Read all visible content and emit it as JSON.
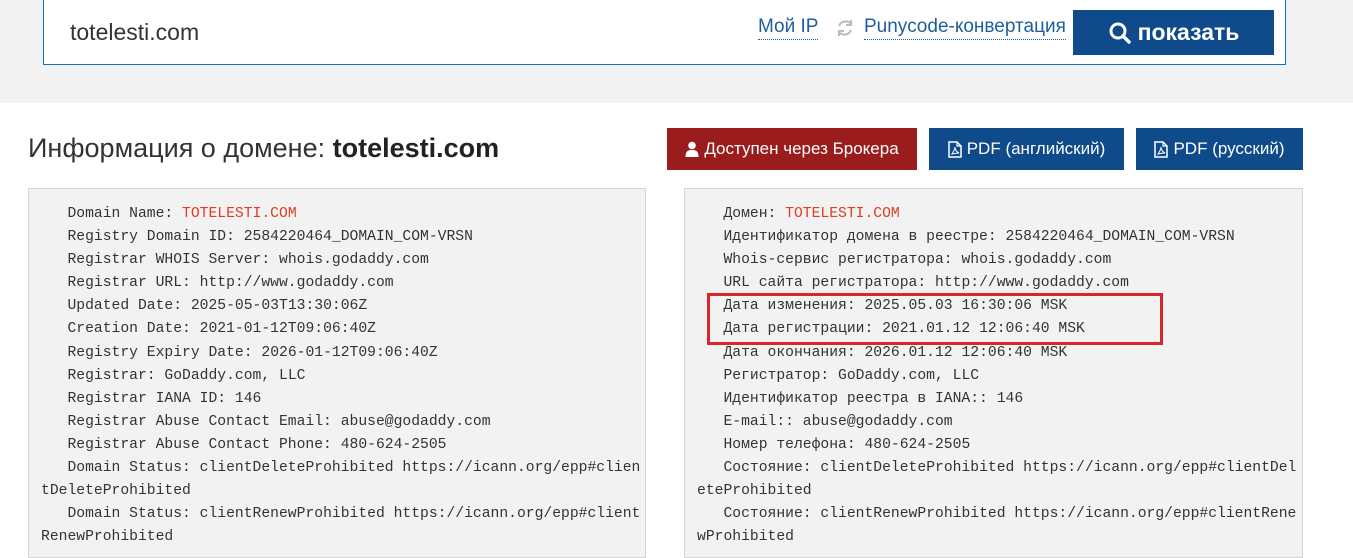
{
  "search": {
    "value": "totelesti.com",
    "my_ip_label": "Мой IP",
    "punycode_label": "Punycode-конвертация",
    "show_label": "показать"
  },
  "title": {
    "prefix": "Информация о домене: ",
    "domain": "totelesti.com"
  },
  "actions": {
    "broker_label": "Доступен через Брокера",
    "pdf_en_label": "PDF (английский)",
    "pdf_ru_label": "PDF (русский)"
  },
  "colors": {
    "primary": "#0f4a8a",
    "broker": "#9b1c1c",
    "domain_value": "#e03c1f",
    "highlight": "#d9262b",
    "band": "#f2f2f2"
  },
  "whois_en": [
    {
      "key": "Domain Name: ",
      "value": "TOTELESTI.COM"
    },
    {
      "key": "Registry Domain ID: ",
      "value": "2584220464_DOMAIN_COM-VRSN"
    },
    {
      "key": "Registrar WHOIS Server: ",
      "value": "whois.godaddy.com"
    },
    {
      "key": "Registrar URL: ",
      "value": "http://www.godaddy.com"
    },
    {
      "key": "Updated Date: ",
      "value": "2025-05-03T13:30:06Z"
    },
    {
      "key": "Creation Date: ",
      "value": "2021-01-12T09:06:40Z"
    },
    {
      "key": "Registry Expiry Date: ",
      "value": "2026-01-12T09:06:40Z"
    },
    {
      "key": "Registrar: ",
      "value": "GoDaddy.com, LLC"
    },
    {
      "key": "Registrar IANA ID: ",
      "value": "146"
    },
    {
      "key": "Registrar Abuse Contact Email: ",
      "value": "abuse@godaddy.com"
    },
    {
      "key": "Registrar Abuse Contact Phone: ",
      "value": "480-624-2505"
    },
    {
      "key": "Domain Status: ",
      "value": "clientDeleteProhibited https://icann.org/epp#clientDeleteProhibited"
    },
    {
      "key": "Domain Status: ",
      "value": "clientRenewProhibited https://icann.org/epp#clientRenewProhibited"
    }
  ],
  "whois_ru": [
    {
      "key": "Домен: ",
      "value": "TOTELESTI.COM"
    },
    {
      "key": "Идентификатор домена в реестре: ",
      "value": "2584220464_DOMAIN_COM-VRSN"
    },
    {
      "key": "Whois-сервис регистратора: ",
      "value": "whois.godaddy.com"
    },
    {
      "key": "URL сайта регистратора: ",
      "value": "http://www.godaddy.com"
    },
    {
      "key": "Дата изменения: ",
      "value": "2025.05.03 16:30:06 MSK"
    },
    {
      "key": "Дата регистрации: ",
      "value": "2021.01.12 12:06:40 MSK"
    },
    {
      "key": "Дата окончания: ",
      "value": "2026.01.12 12:06:40 MSK"
    },
    {
      "key": "Регистратор: ",
      "value": "GoDaddy.com, LLC"
    },
    {
      "key": "Идентификатор реестра в IANA:: ",
      "value": "146"
    },
    {
      "key": "E-mail:: ",
      "value": "abuse@godaddy.com"
    },
    {
      "key": "Номер телефона: ",
      "value": "480-624-2505"
    },
    {
      "key": "Состояние: ",
      "value": "clientDeleteProhibited https://icann.org/epp#clientDeleteProhibited"
    },
    {
      "key": "Состояние: ",
      "value": "clientRenewProhibited https://icann.org/epp#clientRenewProhibited"
    }
  ]
}
